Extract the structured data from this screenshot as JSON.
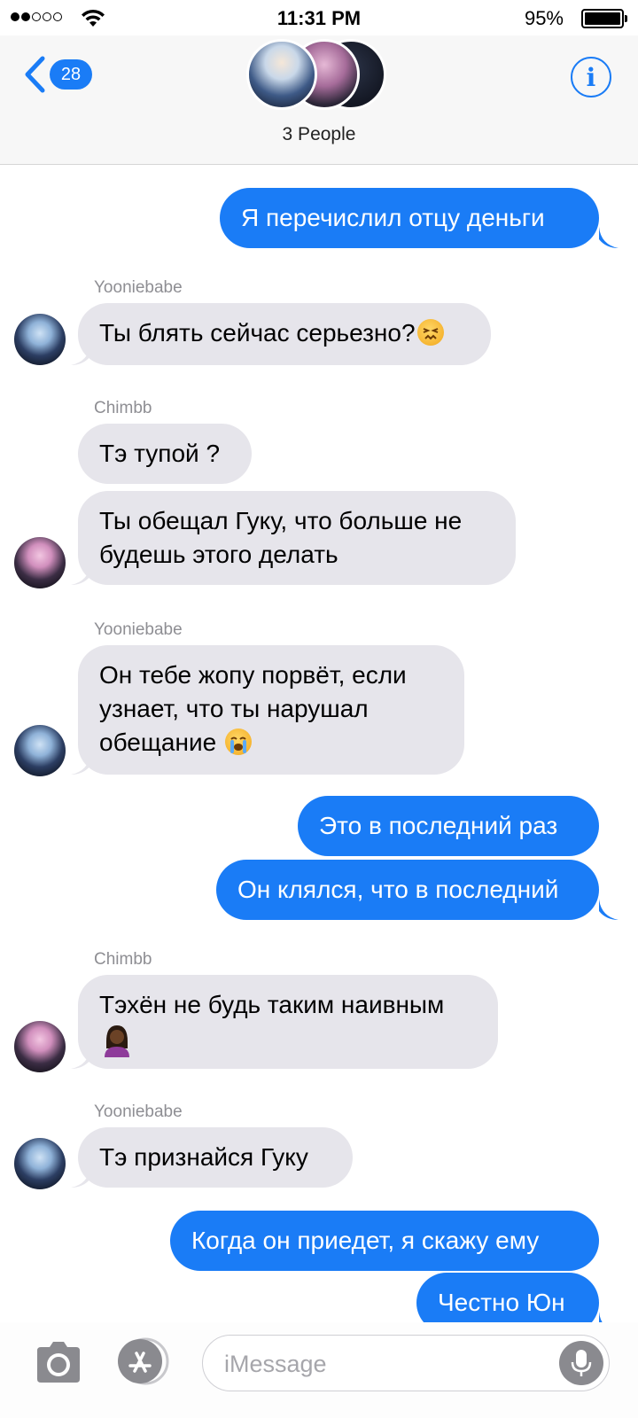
{
  "status_bar": {
    "time": "11:31 PM",
    "battery_percent": "95%",
    "signal_bars": 2,
    "signal_total": 5
  },
  "header": {
    "back_count": "28",
    "title": "3 People",
    "info_icon": "info-circle-icon",
    "back_icon": "chevron-left-icon"
  },
  "colors": {
    "accent": "#1a7cf6",
    "incoming_bubble": "#e6e5eb",
    "sender_label": "#8e8e93"
  },
  "messages": [
    {
      "from": "me",
      "text": "Я перечислил отцу деньги"
    },
    {
      "sender": "Yooniebabe",
      "text": "Ты блять сейчас серьезно?",
      "emoji": "confounded-face"
    },
    {
      "sender": "Chimbb",
      "text": "Тэ тупой ?"
    },
    {
      "from": "Chimbb",
      "line1": "Ты обещал Гуку, что больше не",
      "line2": "будешь этого делать"
    },
    {
      "sender": "Yooniebabe",
      "line1": "Он тебе жопу порвёт, если",
      "line2": "узнает, что ты нарушал",
      "line3": "обещание",
      "emoji": "loudly-crying-face"
    },
    {
      "from": "me",
      "text": "Это в последний раз"
    },
    {
      "from": "me",
      "text": "Он клялся, что в последний"
    },
    {
      "sender": "Chimbb",
      "line1": "Тэхён не будь таким наивным",
      "emoji": "person-emoji"
    },
    {
      "sender": "Yooniebabe",
      "text": "Тэ признайся Гуку"
    },
    {
      "from": "me",
      "text": "Когда он приедет, я скажу ему"
    },
    {
      "from": "me",
      "text": "Честно Юн"
    }
  ],
  "input_bar": {
    "placeholder": "iMessage",
    "camera_icon": "camera-icon",
    "apps_icon": "app-store-icon",
    "mic_icon": "microphone-icon"
  }
}
